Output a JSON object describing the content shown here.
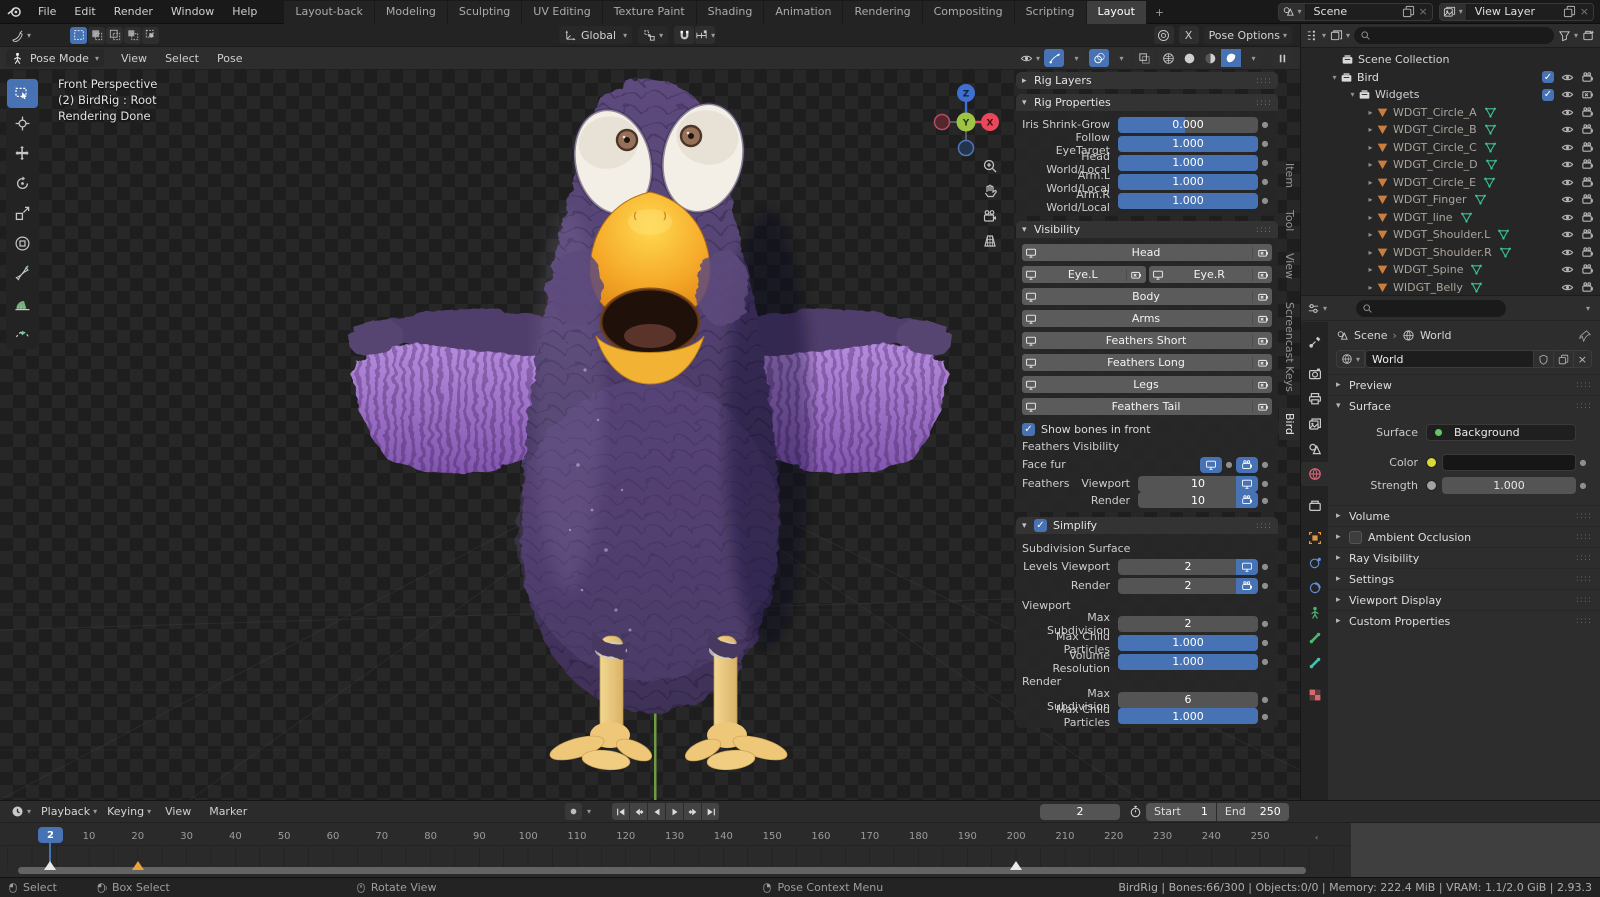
{
  "topbar": {
    "menus": [
      "File",
      "Edit",
      "Render",
      "Window",
      "Help"
    ],
    "workspaces": [
      "Layout-back",
      "Modeling",
      "Sculpting",
      "UV Editing",
      "Texture Paint",
      "Shading",
      "Animation",
      "Rendering",
      "Compositing",
      "Scripting",
      "Layout"
    ],
    "active_workspace": "Layout",
    "add_workspace": "+",
    "scene_label": "Scene",
    "view_layer_label": "View Layer"
  },
  "tool_settings": {
    "orientation": "Global",
    "x_mirror": "X",
    "pose_options": "Pose Options"
  },
  "viewport": {
    "mode": "Pose Mode",
    "menus": [
      "View",
      "Select",
      "Pose"
    ],
    "overlay": [
      "Front Perspective",
      "(2) BirdRig : Root",
      "Rendering Done"
    ],
    "toolbar_tools": [
      "box-select",
      "cursor",
      "move",
      "rotate",
      "scale",
      "transform",
      "annotate",
      "measure",
      "pose-breakdowner"
    ],
    "gizmo_axes": {
      "x": "X",
      "y": "Y",
      "z": "Z"
    }
  },
  "sidebar": {
    "tabs": [
      "Item",
      "Tool",
      "View",
      "Screencast Keys",
      "Bird"
    ],
    "active_tab": "Bird",
    "rig_layers_title": "Rig Layers",
    "rig_properties": {
      "title": "Rig Properties",
      "rows": [
        {
          "label": "Iris Shrink-Grow",
          "value": "0.000",
          "fill": 0.48
        },
        {
          "label": "Follow EyeTarget",
          "value": "1.000",
          "fill": 1
        },
        {
          "label": "Head World/Local",
          "value": "1.000",
          "fill": 1
        },
        {
          "label": "Arm.L World/Local",
          "value": "1.000",
          "fill": 1
        },
        {
          "label": "Arm.R World/Local",
          "value": "1.000",
          "fill": 1
        }
      ]
    },
    "visibility": {
      "title": "Visibility",
      "rows": [
        [
          "Head"
        ],
        [
          "Eye.L",
          "Eye.R"
        ],
        [
          "Body"
        ],
        [
          "Arms"
        ],
        [
          "Feathers Short"
        ],
        [
          "Feathers Long"
        ],
        [
          "Legs"
        ],
        [
          "Feathers Tail"
        ]
      ],
      "show_bones": "Show bones in front",
      "feathers_visibility": "Feathers Visibility",
      "face_fur": "Face fur",
      "feathers": "Feathers",
      "viewport_label": "Viewport",
      "viewport_value": "10",
      "render_label": "Render",
      "render_value": "10"
    },
    "simplify": {
      "title": "Simplify",
      "subdivision_surface": "Subdivision Surface",
      "levels_viewport_label": "Levels Viewport",
      "levels_viewport": "2",
      "render_label": "Render",
      "render": "2",
      "viewport_group": "Viewport",
      "max_subdivision_label": "Max Subdivision",
      "max_subdivision": "2",
      "max_child_label": "Max Child Particles",
      "max_child": "1.000",
      "volume_resolution_label": "Volume Resolution",
      "volume_resolution": "1.000",
      "render_group": "Render",
      "r_max_subdivision_label": "Max Subdivision",
      "r_max_subdivision": "6",
      "r_max_child_label": "Max Child Particles",
      "r_max_child": "1.000"
    }
  },
  "outliner": {
    "scene_collection": "Scene Collection",
    "bird": "Bird",
    "widgets": "Widgets",
    "widget_items": [
      "WDGT_Circle_A",
      "WDGT_Circle_B",
      "WDGT_Circle_C",
      "WDGT_Circle_D",
      "WDGT_Circle_E",
      "WDGT_Finger",
      "WDGT_line",
      "WDGT_Shoulder.L",
      "WDGT_Shoulder.R",
      "WDGT_Spine",
      "WIDGT_Belly"
    ]
  },
  "properties": {
    "breadcrumb": {
      "scene": "Scene",
      "sep": "›",
      "world": "World"
    },
    "datablock": "World",
    "tabs": [
      "tool",
      "render",
      "output",
      "view-layer",
      "scene",
      "world",
      "collection",
      "object",
      "physics",
      "constraints",
      "object-data",
      "bone",
      "bone-constraint",
      "texture"
    ],
    "active_tab": "world",
    "panels": {
      "preview": "Preview",
      "surface_title": "Surface",
      "surface_label": "Surface",
      "surface_value": "Background",
      "color_label": "Color",
      "strength_label": "Strength",
      "strength_value": "1.000",
      "collapsed": [
        "Volume",
        "Ambient Occlusion",
        "Ray Visibility",
        "Settings",
        "Viewport Display",
        "Custom Properties"
      ]
    }
  },
  "timeline": {
    "menus": [
      "Playback",
      "Keying",
      "View",
      "Marker"
    ],
    "playback": [
      "jump-to-start",
      "jump-to-prev-keyframe",
      "play-reverse",
      "play",
      "jump-to-next-keyframe",
      "jump-to-end"
    ],
    "current_frame": "2",
    "ticks": [
      "10",
      "20",
      "30",
      "40",
      "50",
      "60",
      "70",
      "80",
      "90",
      "100",
      "110",
      "120",
      "130",
      "140",
      "150",
      "160",
      "170",
      "180",
      "190",
      "200",
      "210",
      "220",
      "230",
      "240",
      "250"
    ],
    "start_label": "Start",
    "start": "1",
    "end_label": "End",
    "end": "250",
    "markers": [
      {
        "frame": 2,
        "color": "white"
      },
      {
        "frame": 20,
        "color": "orange"
      },
      {
        "frame": 200,
        "color": "white"
      }
    ]
  },
  "status_bar": {
    "hints": [
      "Select",
      "Box Select",
      "Rotate View",
      "Pose Context Menu"
    ],
    "info": "BirdRig | Bones:66/300 | Objects:0/0 | Memory: 222.4 MiB | VRAM: 1.1/2.0 GiB | 2.93.3"
  },
  "colors": {
    "accent": "#4772b3",
    "axis_x": "#e8485a",
    "axis_y": "#9ec445",
    "axis_z": "#3f6fd1",
    "wing": "#a678d6",
    "body": "#4e3d6b",
    "beak": "#f5a828"
  }
}
